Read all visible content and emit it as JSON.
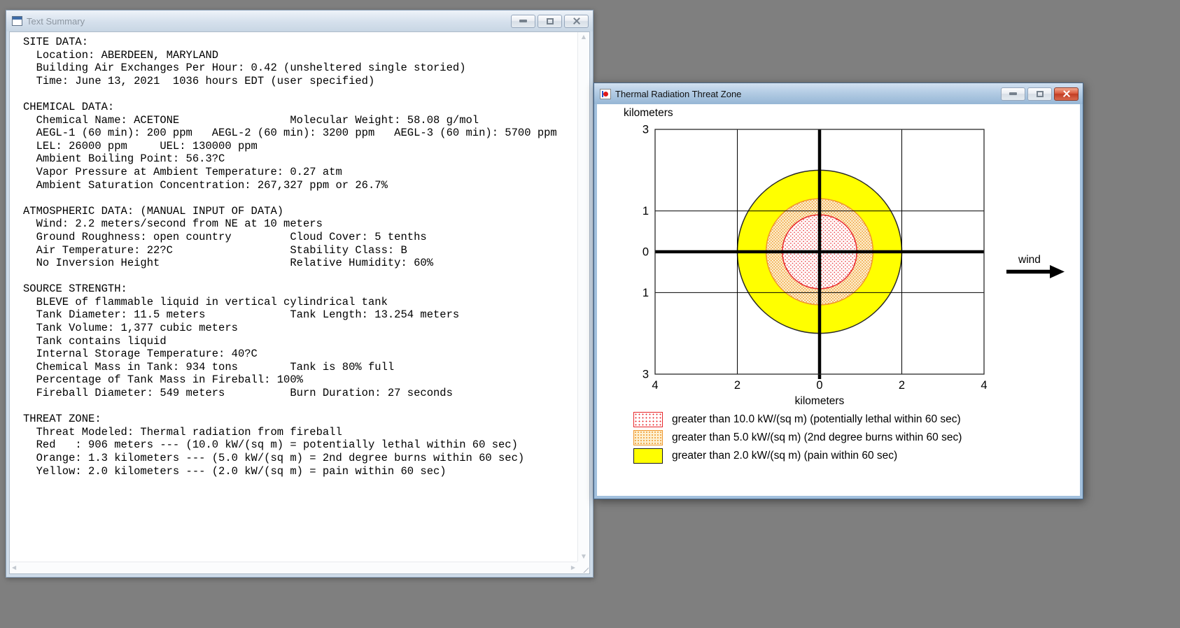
{
  "desktop": {
    "background": "#7f7f7f"
  },
  "text_summary_window": {
    "title": "Text Summary",
    "icon": "text-document-window-icon",
    "controls": [
      {
        "name": "minimize"
      },
      {
        "name": "maximize"
      },
      {
        "name": "close"
      }
    ],
    "content_lines": [
      "SITE DATA:",
      "  Location: ABERDEEN, MARYLAND",
      "  Building Air Exchanges Per Hour: 0.42 (unsheltered single storied)",
      "  Time: June 13, 2021  1036 hours EDT (user specified)",
      "",
      "CHEMICAL DATA:",
      "  Chemical Name: ACETONE                 Molecular Weight: 58.08 g/mol",
      "  AEGL-1 (60 min): 200 ppm   AEGL-2 (60 min): 3200 ppm   AEGL-3 (60 min): 5700 ppm",
      "  LEL: 26000 ppm     UEL: 130000 ppm",
      "  Ambient Boiling Point: 56.3?C",
      "  Vapor Pressure at Ambient Temperature: 0.27 atm",
      "  Ambient Saturation Concentration: 267,327 ppm or 26.7%",
      "",
      "ATMOSPHERIC DATA: (MANUAL INPUT OF DATA)",
      "  Wind: 2.2 meters/second from NE at 10 meters",
      "  Ground Roughness: open country         Cloud Cover: 5 tenths",
      "  Air Temperature: 22?C                  Stability Class: B",
      "  No Inversion Height                    Relative Humidity: 60%",
      "",
      "SOURCE STRENGTH:",
      "  BLEVE of flammable liquid in vertical cylindrical tank",
      "  Tank Diameter: 11.5 meters             Tank Length: 13.254 meters",
      "  Tank Volume: 1,377 cubic meters",
      "  Tank contains liquid",
      "  Internal Storage Temperature: 40?C",
      "  Chemical Mass in Tank: 934 tons        Tank is 80% full",
      "  Percentage of Tank Mass in Fireball: 100%",
      "  Fireball Diameter: 549 meters          Burn Duration: 27 seconds",
      "",
      "THREAT ZONE:",
      "  Threat Modeled: Thermal radiation from fireball",
      "  Red   : 906 meters --- (10.0 kW/(sq m) = potentially lethal within 60 sec)",
      "  Orange: 1.3 kilometers --- (5.0 kW/(sq m) = 2nd degree burns within 60 sec)",
      "  Yellow: 2.0 kilometers --- (2.0 kW/(sq m) = pain within 60 sec)"
    ]
  },
  "threat_zone_window": {
    "title": "Thermal Radiation Threat Zone",
    "icon": "threat-plot-icon",
    "controls": [
      {
        "name": "minimize"
      },
      {
        "name": "maximize"
      },
      {
        "name": "close"
      }
    ]
  },
  "chart_data": {
    "type": "area",
    "title": "Thermal Radiation Threat Zone",
    "xlabel": "kilometers",
    "ylabel": "kilometers",
    "xlim": [
      -4,
      4
    ],
    "ylim": [
      -3,
      3
    ],
    "x_tick_values": [
      -4,
      -2,
      0,
      2,
      4
    ],
    "x_tick_labels": [
      "4",
      "2",
      "0",
      "2",
      "4"
    ],
    "y_tick_values": [
      3,
      1,
      0,
      -1,
      -3
    ],
    "y_tick_labels": [
      "3",
      "1",
      "0",
      "1",
      "3"
    ],
    "grid": true,
    "center": [
      0,
      0
    ],
    "zones": [
      {
        "name": "yellow",
        "radius_km": 2.0,
        "threshold_kw_sqm": 2.0,
        "effect": "pain within 60 sec",
        "pattern": "solid",
        "fill": "#ffff00",
        "stroke": "#2a2a2a"
      },
      {
        "name": "orange",
        "radius_km": 1.3,
        "threshold_kw_sqm": 5.0,
        "effect": "2nd degree burns within 60 sec",
        "pattern": "dots",
        "fill": "#fdf0d2",
        "dot": "#ef9726",
        "stroke": "#f0962c",
        "dot_spacing": 4.2,
        "dot_size": 0.9
      },
      {
        "name": "red",
        "radius_km": 0.906,
        "threshold_kw_sqm": 10.0,
        "effect": "potentially lethal within 60 sec",
        "pattern": "dots",
        "fill": "#ffffff",
        "dot": "#e8262a",
        "stroke": "#e8262a",
        "dot_spacing": 5.2,
        "dot_size": 0.8
      }
    ],
    "legend": [
      {
        "swatch": "red-dots",
        "label": "greater than 10.0 kW/(sq m) (potentially lethal within 60 sec)"
      },
      {
        "swatch": "orange-dots",
        "label": "greater than 5.0 kW/(sq m) (2nd degree burns within 60 sec)"
      },
      {
        "swatch": "yellow-solid",
        "label": "greater than 2.0 kW/(sq m) (pain within 60 sec)"
      }
    ],
    "legend_position": "below",
    "annotations": [
      {
        "type": "arrow",
        "label": "wind",
        "direction": "right"
      }
    ]
  }
}
